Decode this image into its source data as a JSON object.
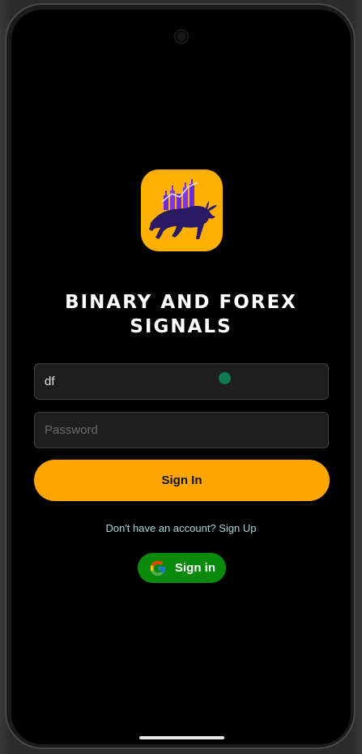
{
  "app": {
    "title_line1": "BINARY AND FOREX",
    "title_line2": "SIGNALS"
  },
  "form": {
    "username": {
      "value": "df",
      "placeholder": ""
    },
    "password": {
      "value": "",
      "placeholder": "Password"
    },
    "signin_label": "Sign In",
    "signup_text": "Don't have an account? Sign Up",
    "google_label": "Sign in"
  },
  "colors": {
    "accent": "#ffa700",
    "logo_bg": "#ffb000",
    "google_button": "#0a8a0a",
    "link": "#a9d6d4",
    "background": "#000000"
  },
  "icons": [
    "bull-chart-logo",
    "google-g-icon",
    "camera-cutout"
  ]
}
